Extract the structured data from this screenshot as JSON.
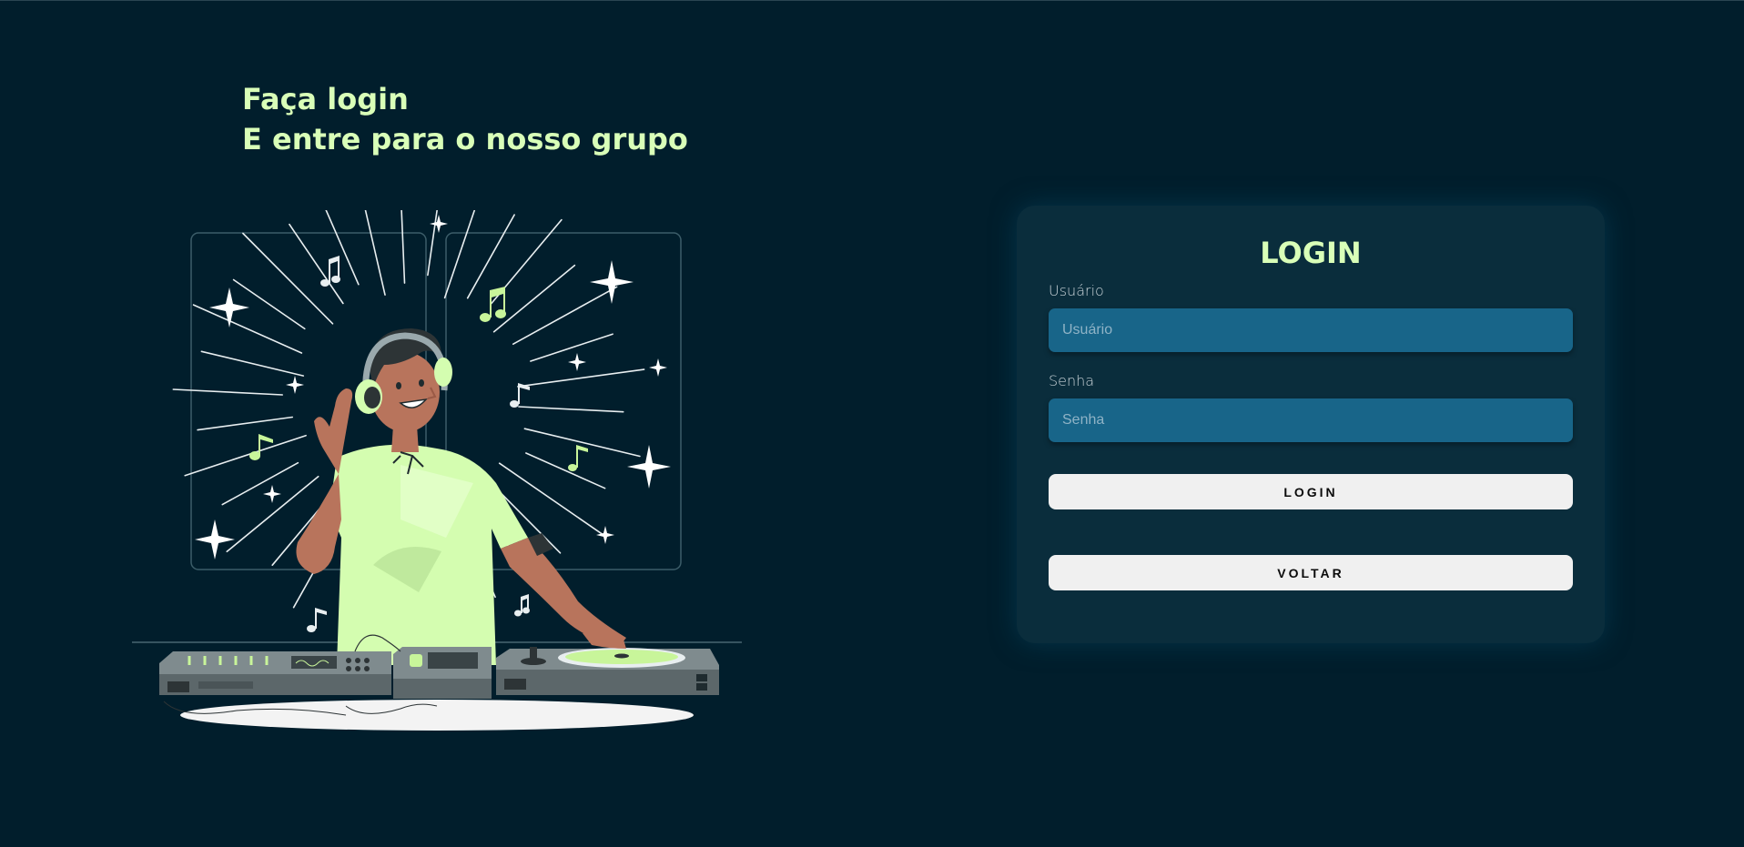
{
  "hero": {
    "line1": "Faça login",
    "line2": "E entre para o nosso grupo"
  },
  "login_form": {
    "title": "LOGIN",
    "username_label": "Usuário",
    "username_placeholder": "Usuário",
    "password_label": "Senha",
    "password_placeholder": "Senha",
    "login_button": "LOGIN",
    "back_button": "VOLTAR"
  },
  "illustration": {
    "subject": "dj-mixing-icon",
    "icons": [
      "music-note-icon",
      "sparkle-icon",
      "headphones-icon",
      "turntable-icon"
    ]
  },
  "colors": {
    "background": "#011e2c",
    "accent": "#d9ffb8",
    "card": "#0a2d3c",
    "input": "#186589",
    "button": "#f0f0f0"
  }
}
